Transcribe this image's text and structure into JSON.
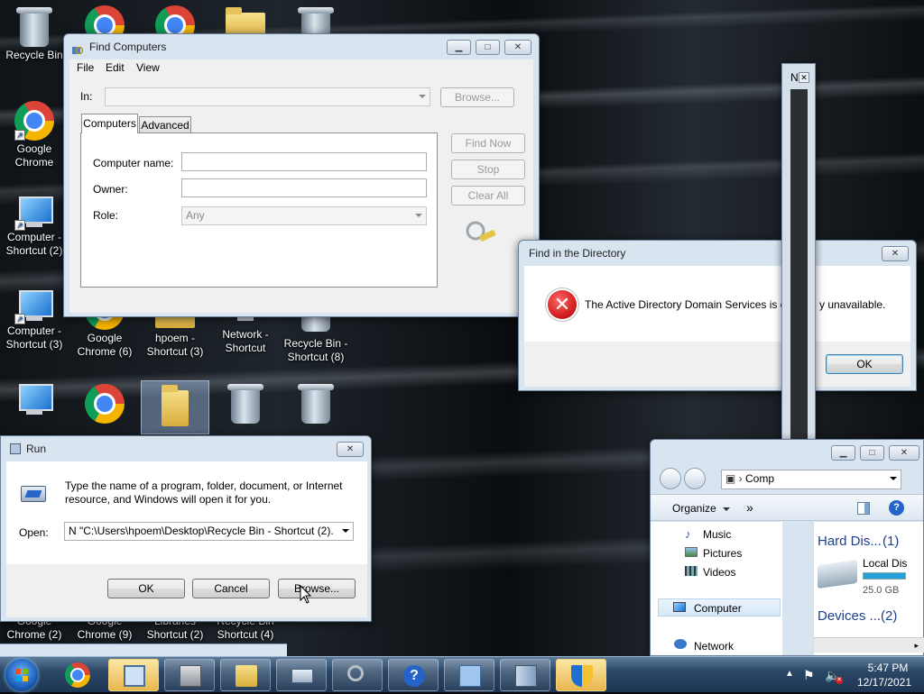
{
  "desktop": {
    "icons": [
      {
        "label": "Recycle Bin",
        "icon": "recycle-bin-icon"
      },
      {
        "label": "Google Chrome",
        "icon": "chrome-icon"
      },
      {
        "label": "Computer - Shortcut (2)",
        "icon": "computer-icon"
      },
      {
        "label": "Computer - Shortcut (3)",
        "icon": "computer-icon"
      },
      {
        "label": "Google Chrome (6)",
        "icon": "chrome-icon"
      },
      {
        "label": "hpoem - Shortcut (3)",
        "icon": "user-folder-icon"
      },
      {
        "label": "Network - Shortcut",
        "icon": "network-icon"
      },
      {
        "label": "Recycle Bin - Shortcut (8)",
        "icon": "recycle-bin-icon"
      },
      {
        "label": "Google Chrome (2)",
        "icon": "chrome-icon"
      },
      {
        "label": "Google Chrome (9)",
        "icon": "chrome-icon"
      },
      {
        "label": "Libraries Shortcut (2)",
        "icon": "libraries-icon"
      },
      {
        "label": "Recycle Bin Shortcut (4)",
        "icon": "recycle-bin-icon"
      }
    ]
  },
  "find_computers": {
    "title": "Find Computers",
    "menu": [
      "File",
      "Edit",
      "View"
    ],
    "in_label": "In:",
    "in_value": "",
    "browse_label": "Browse...",
    "tabs": [
      "Computers",
      "Advanced"
    ],
    "computer_name_label": "Computer name:",
    "owner_label": "Owner:",
    "role_label": "Role:",
    "role_value": "Any",
    "find_now_label": "Find Now",
    "stop_label": "Stop",
    "clear_all_label": "Clear All"
  },
  "find_dir": {
    "title": "Find in the Directory",
    "message": "The Active Directory Domain Services is cu",
    "message_tail": "y unavailable.",
    "ok_label": "OK"
  },
  "narrow_window": {
    "title": "N"
  },
  "run": {
    "title": "Run",
    "description": "Type the name of a program, folder, document, or Internet resource, and Windows will open it for you.",
    "open_label": "Open:",
    "open_value": "N \"C:\\Users\\hpoem\\Desktop\\Recycle Bin - Shortcut (2).",
    "ok_label": "OK",
    "cancel_label": "Cancel",
    "browse_label": "Browse..."
  },
  "explorer": {
    "address": "Comp",
    "organize_label": "Organize",
    "more_label": "»",
    "nav_items": [
      "Music",
      "Pictures",
      "Videos",
      "Computer",
      "Network"
    ],
    "group_hdd": "Hard Dis...",
    "group_hdd_count": "(1)",
    "drive_label": "Local Dis",
    "drive_size": "25.0 GB",
    "group_devices": "Devices ...",
    "group_devices_count": "(2)"
  },
  "taskbar": {
    "time": "5:47 PM",
    "date": "12/17/2021",
    "buttons": [
      "start-orb-icon",
      "chrome-icon",
      "network-admin-icon",
      "server-icon",
      "folder-icon",
      "run-icon",
      "search-icon",
      "help-icon",
      "find-icon",
      "files-icon",
      "shield-icon"
    ]
  },
  "colors": {
    "error": "#d42020",
    "taskbar_active": "#e9b64c",
    "selection": "#3399ff"
  }
}
